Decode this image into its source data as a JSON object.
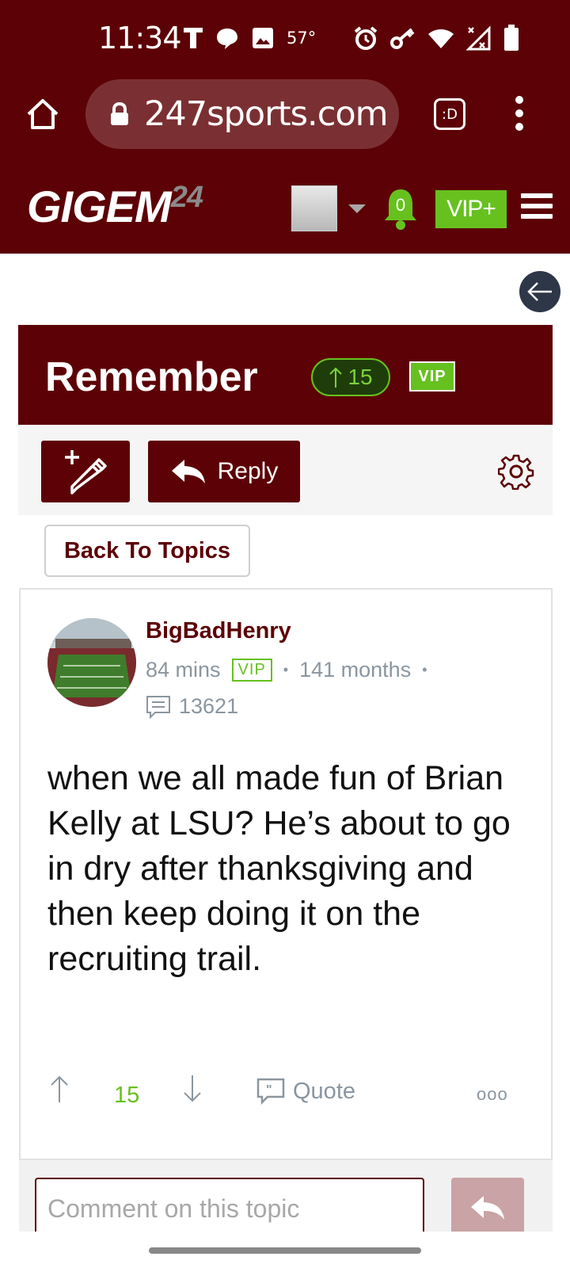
{
  "status_bar": {
    "time": "11:34",
    "temperature": "57°"
  },
  "browser": {
    "url": "247sports.com",
    "tab_icon": ":D"
  },
  "site": {
    "logo": "GIGEM",
    "logo_suffix": "24",
    "notifications": "0",
    "vip_plus": "VIP+"
  },
  "topic": {
    "title": "Remember",
    "upvotes": "15",
    "vip": "VIP"
  },
  "actions": {
    "reply": "Reply",
    "back_to_topics": "Back To Topics"
  },
  "post": {
    "username": "BigBadHenry",
    "age": "84 mins",
    "vip": "VIP",
    "tenure": "141 months",
    "post_count": "13621",
    "body": "when we all made fun of Brian Kelly at LSU? He’s about to go in dry after thanksgiving and then keep doing it on the recruiting trail.",
    "votes": "15",
    "quote": "Quote",
    "more": "ooo"
  },
  "comment": {
    "placeholder": "Comment on this topic"
  },
  "colors": {
    "maroon": "#5c0105",
    "green": "#66c11f",
    "grey_text": "#8a96a0"
  }
}
